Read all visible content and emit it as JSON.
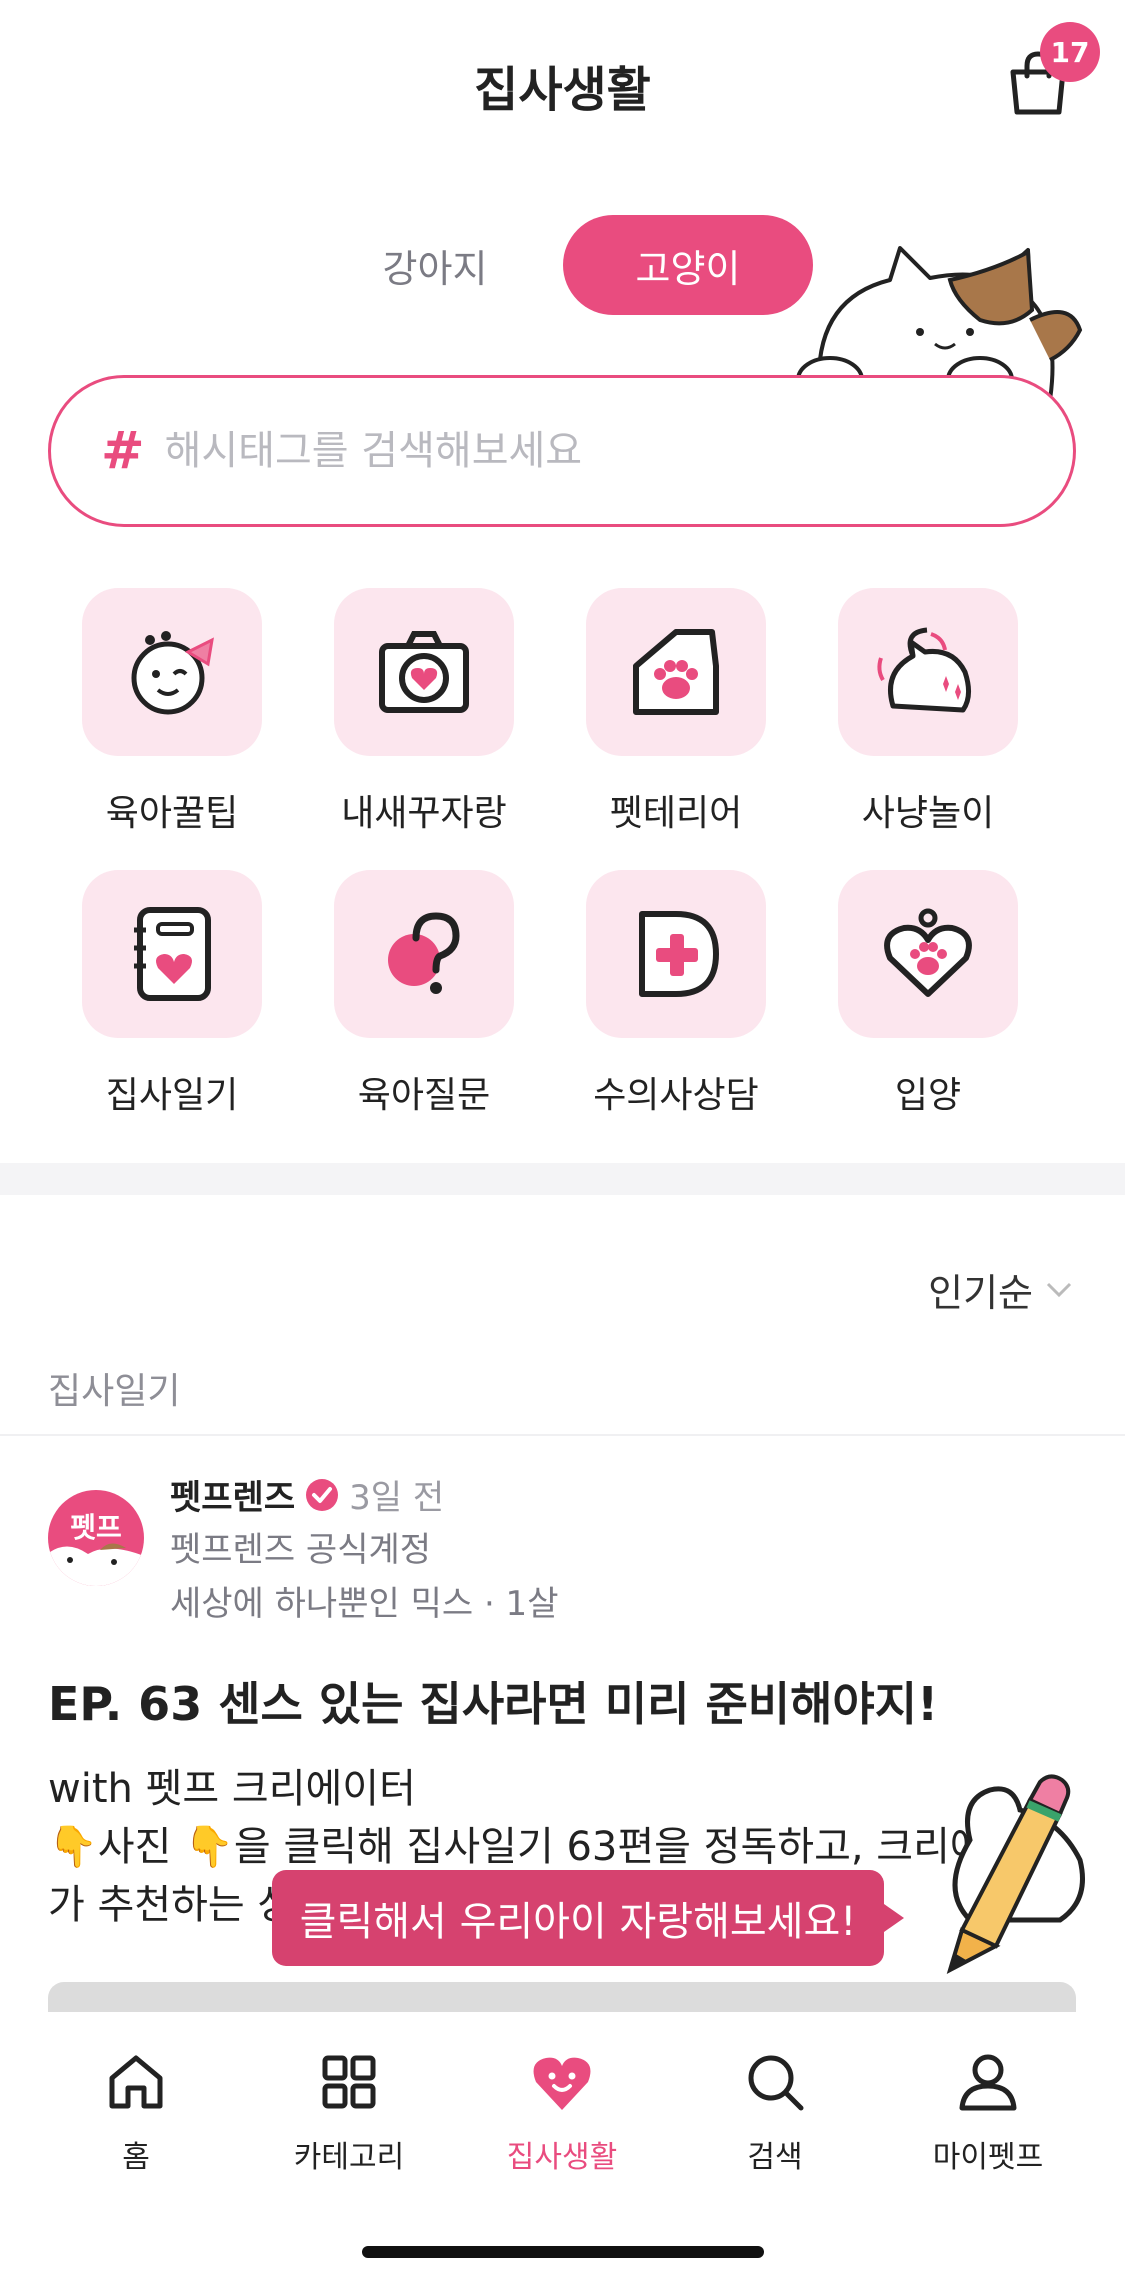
{
  "header": {
    "title": "집사생활",
    "cart_badge": "17"
  },
  "segments": {
    "dog": "강아지",
    "cat": "고양이",
    "selected": "고양이"
  },
  "search": {
    "hash": "#",
    "placeholder": "해시태그를 검색해보세요"
  },
  "categories": [
    {
      "label": "육아꿀팁",
      "icon": "cat-face-bow-icon"
    },
    {
      "label": "내새꾸자랑",
      "icon": "camera-heart-icon"
    },
    {
      "label": "펫테리어",
      "icon": "house-paw-icon"
    },
    {
      "label": "사냥놀이",
      "icon": "playing-cat-icon"
    },
    {
      "label": "집사일기",
      "icon": "diary-heart-icon"
    },
    {
      "label": "육아질문",
      "icon": "question-icon"
    },
    {
      "label": "수의사상담",
      "icon": "medical-cross-icon"
    },
    {
      "label": "입양",
      "icon": "heart-paw-tag-icon"
    }
  ],
  "feed": {
    "sort_label": "인기순",
    "section_label": "집사일기",
    "post": {
      "avatar_text": "펫프",
      "author": "펫프렌즈",
      "time": "3일 전",
      "author_sub": "펫프렌즈 공식계정",
      "pet_info": "세상에 하나뿐인 믹스 · 1살",
      "title": "EP. 63 센스 있는 집사라면 미리 준비해야지!",
      "body_line1": "with 펫프 크리에이터",
      "body_line2": "👇사진 👇을 클릭해 집사일기 63편을 정독하고, 크리에이터",
      "body_line3": "가 추천하는 상"
    }
  },
  "tooltip": {
    "text": "클릭해서 우리아이 자랑해보세요!"
  },
  "tabbar": {
    "items": [
      {
        "label": "홈",
        "icon": "home-icon"
      },
      {
        "label": "카테고리",
        "icon": "grid-icon"
      },
      {
        "label": "집사생활",
        "icon": "heart-face-icon"
      },
      {
        "label": "검색",
        "icon": "search-icon"
      },
      {
        "label": "마이펫프",
        "icon": "person-icon"
      }
    ],
    "active": "집사생활"
  },
  "colors": {
    "accent": "#e94c7f",
    "tile_bg": "#fce6ee",
    "tooltip_bg": "#d6426f"
  }
}
